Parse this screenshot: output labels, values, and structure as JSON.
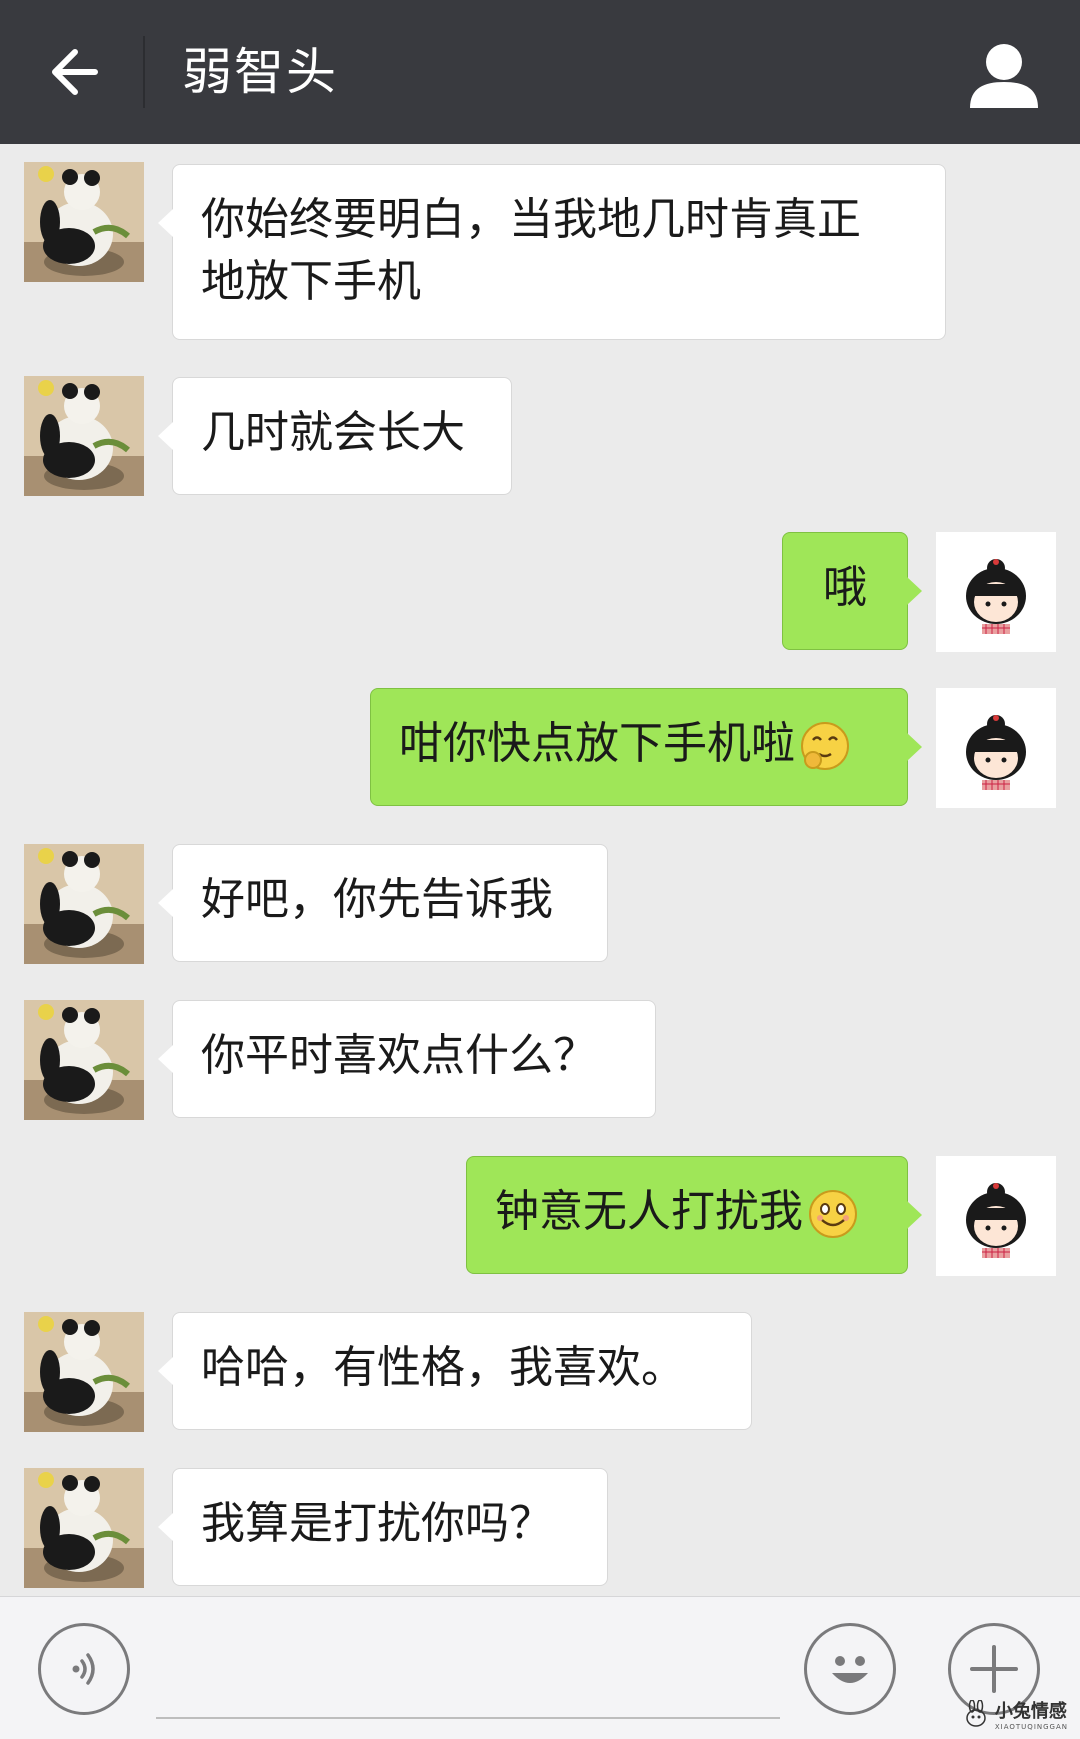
{
  "header": {
    "title": "弱智头"
  },
  "icons": {
    "back": "arrow-left-icon",
    "profile": "person-icon",
    "voice": "voice-icon",
    "emoji": "smiley-face-icon",
    "more": "plus-icon"
  },
  "colors": {
    "header_bg": "#393a3f",
    "chat_bg": "#ebebeb",
    "incoming_bubble": "#ffffff",
    "outgoing_bubble": "#9fe658"
  },
  "messages": [
    {
      "side": "in",
      "text_lines": [
        "你始终要明白，当我地几时肯真正",
        "地放下手机"
      ]
    },
    {
      "side": "in",
      "text": "几时就会长大"
    },
    {
      "side": "out",
      "text": "哦"
    },
    {
      "side": "out",
      "text": "咁你快点放下手机啦",
      "emoji": "thinking-smiley"
    },
    {
      "side": "in",
      "text": "好吧，你先告诉我"
    },
    {
      "side": "in",
      "text": "你平时喜欢点什么？"
    },
    {
      "side": "out",
      "text": "钟意无人打扰我",
      "emoji": "smiling-face"
    },
    {
      "side": "in",
      "text": "哈哈，有性格，我喜欢。"
    },
    {
      "side": "in",
      "text": "我算是打扰你吗？"
    }
  ],
  "watermark": {
    "main": "小兔情感",
    "sub": "XIAOTUQINGGAN"
  }
}
